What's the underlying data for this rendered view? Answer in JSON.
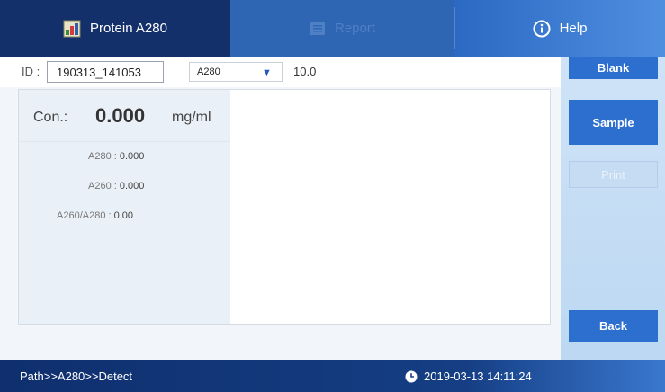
{
  "tabs": [
    {
      "label": "Protein A280",
      "icon": "protein-app-icon",
      "active": true
    },
    {
      "label": "Report",
      "icon": "report-icon",
      "active": false
    },
    {
      "label": "Help",
      "icon": "info-icon",
      "active": false
    }
  ],
  "id_field": {
    "label": "ID :",
    "value": "190313_141053"
  },
  "method_select": {
    "value": "A280"
  },
  "factor": "10.0",
  "results": {
    "con_label": "Con.:",
    "con_value": "0.000",
    "con_unit": "mg/ml",
    "rows": [
      {
        "label": "A280 : ",
        "value": "0.000"
      },
      {
        "label": "A260 : ",
        "value": "0.000"
      },
      {
        "label": "A260/A280 : ",
        "value": "0.00"
      }
    ]
  },
  "sidebar": {
    "blank": "Blank",
    "sample": "Sample",
    "print": "Print",
    "back": "Back"
  },
  "status": {
    "path": "Path>>A280>>Detect",
    "datetime": "2019-03-13 14:11:24"
  },
  "colors": {
    "accent": "#2d6fcf",
    "topbar_dark": "#13306a",
    "sidebar_bg": "#cfe3f7"
  }
}
